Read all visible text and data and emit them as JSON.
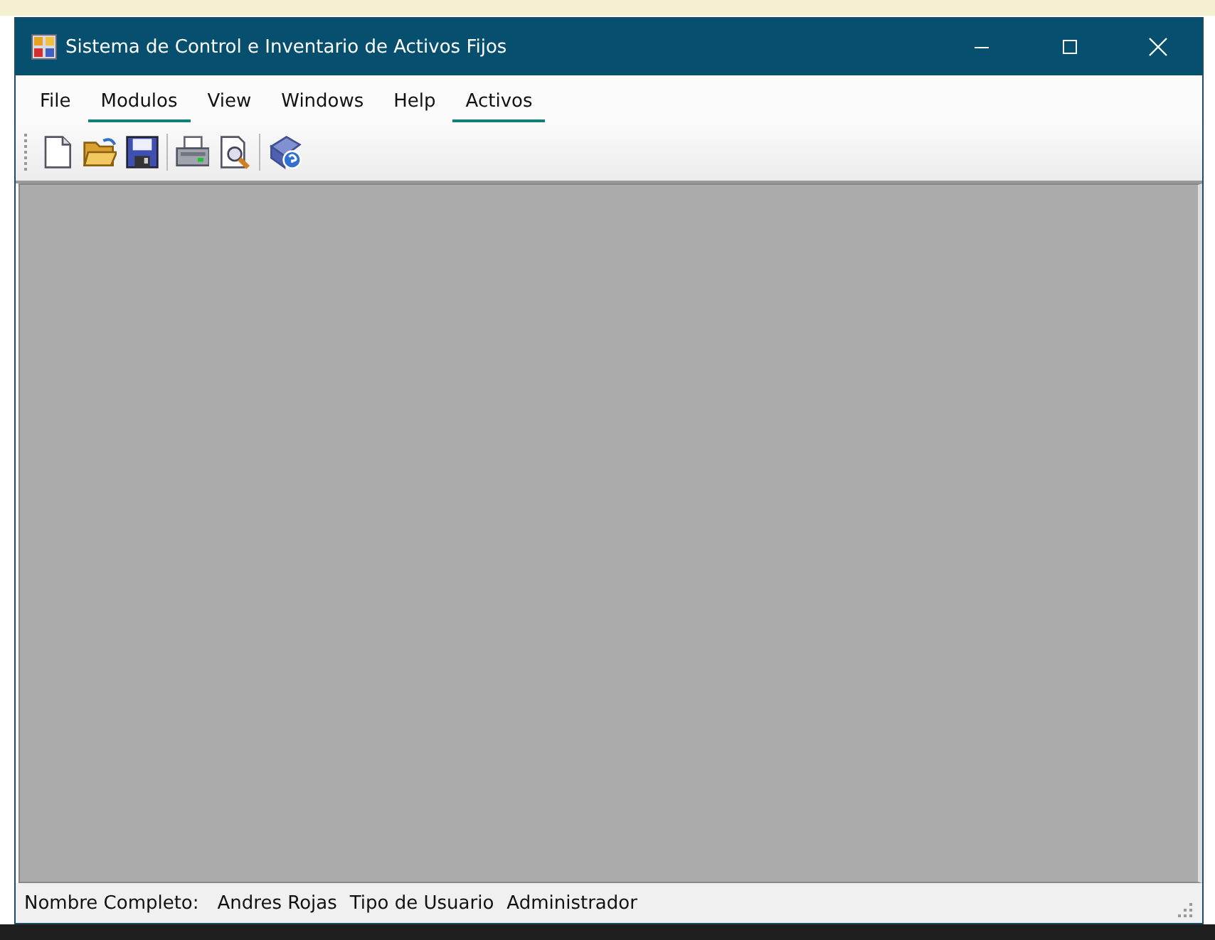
{
  "window": {
    "title": "Sistema de Control e Inventario de Activos Fijos"
  },
  "menu": [
    {
      "label": "File",
      "underlined": false
    },
    {
      "label": "Modulos",
      "underlined": true
    },
    {
      "label": "View",
      "underlined": false
    },
    {
      "label": "Windows",
      "underlined": false
    },
    {
      "label": "Help",
      "underlined": false
    },
    {
      "label": "Activos",
      "underlined": true
    }
  ],
  "toolbar": [
    {
      "kind": "new"
    },
    {
      "kind": "open"
    },
    {
      "kind": "save"
    },
    {
      "kind": "separator"
    },
    {
      "kind": "print"
    },
    {
      "kind": "preview"
    },
    {
      "kind": "separator"
    },
    {
      "kind": "help"
    }
  ],
  "status_bar": [
    "Nombre Completo:",
    "Andres Rojas",
    "Tipo de Usuario",
    "Administrador"
  ]
}
